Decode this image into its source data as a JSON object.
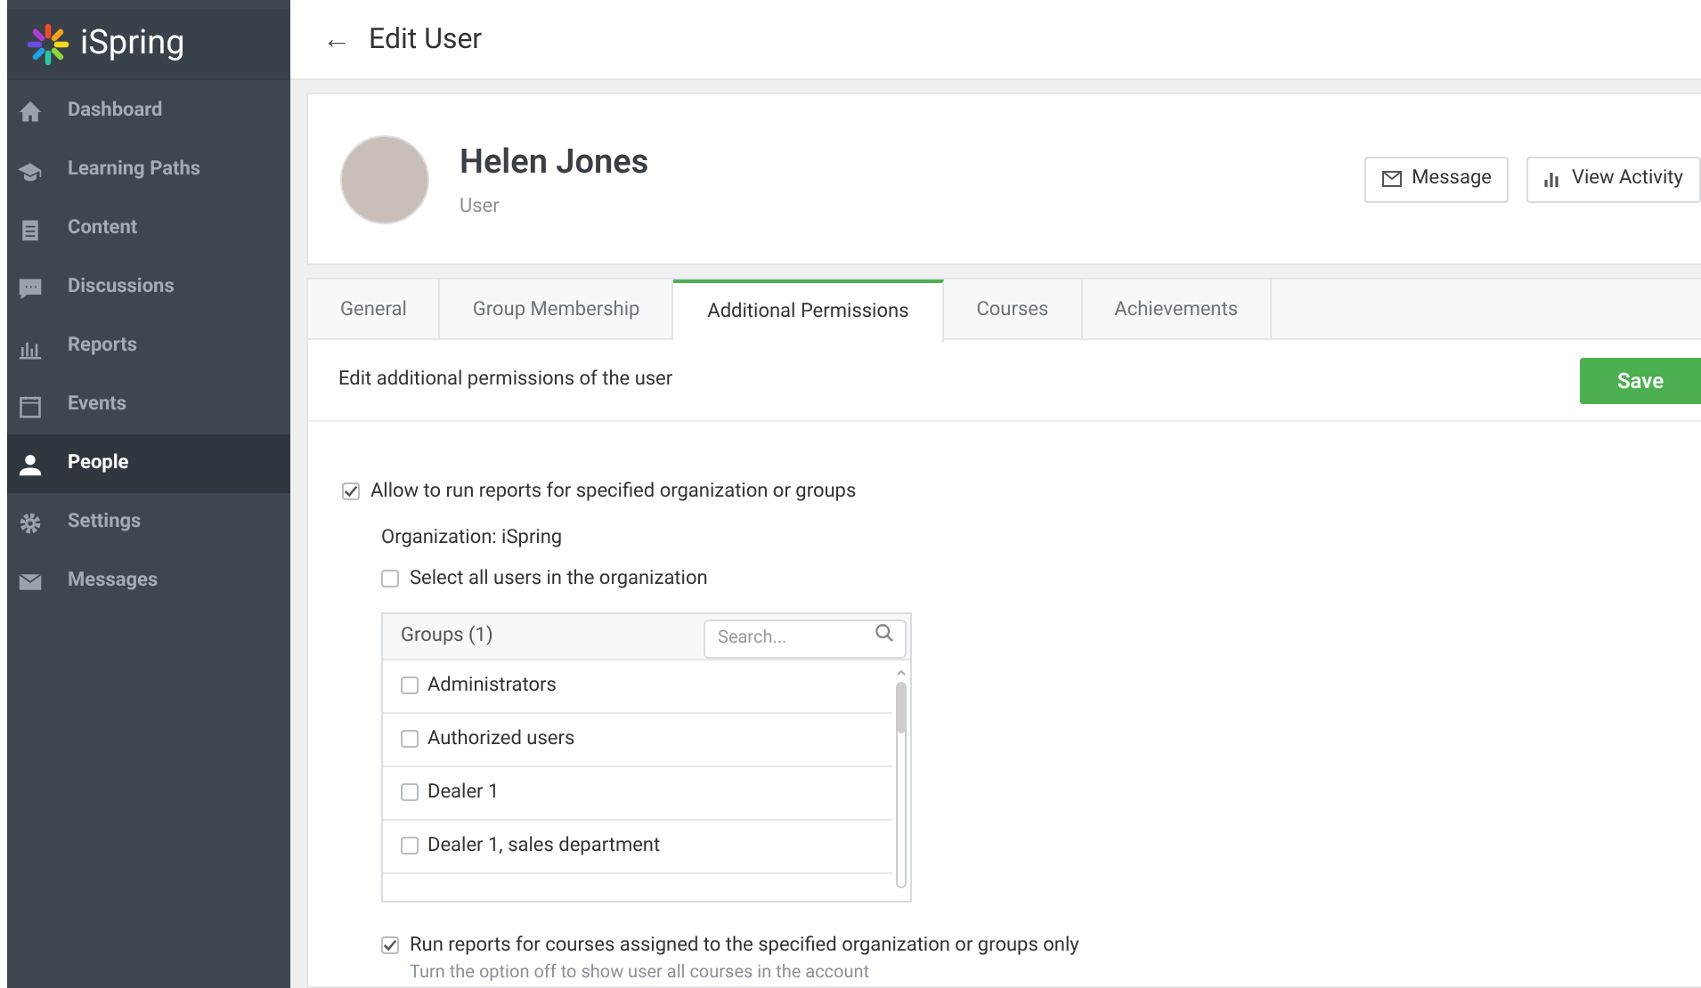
{
  "sidebar": {
    "logo": "iSpring",
    "items": [
      {
        "label": "Dashboard",
        "selected": false
      },
      {
        "label": "Learning Paths",
        "selected": false
      },
      {
        "label": "Content",
        "selected": false
      },
      {
        "label": "Discussions",
        "selected": false
      },
      {
        "label": "Reports",
        "selected": false
      },
      {
        "label": "Events",
        "selected": false
      },
      {
        "label": "People",
        "selected": true
      },
      {
        "label": "Settings",
        "selected": false
      },
      {
        "label": "Messages",
        "selected": false
      }
    ]
  },
  "header": {
    "back": "←",
    "title": "Edit User"
  },
  "user": {
    "name": "Helen Jones",
    "role": "User",
    "actions": [
      {
        "label": "Message"
      },
      {
        "label": "View Activity"
      }
    ]
  },
  "tabs": [
    {
      "label": "General",
      "selected": false
    },
    {
      "label": "Group Membership",
      "selected": false
    },
    {
      "label": "Additional Permissions",
      "selected": true
    },
    {
      "label": "Courses",
      "selected": false
    },
    {
      "label": "Achievements",
      "selected": false
    }
  ],
  "description": "Edit additional permissions of the user",
  "save": "Save",
  "allow": {
    "label": "Allow to run reports for specified organization or groups",
    "checked": true
  },
  "organization": "Organization: iSpring",
  "select_all": {
    "label": "Select all users in the organization",
    "checked": false
  },
  "groups": {
    "title": "Groups (1)",
    "search_placeholder": "Search...",
    "items": [
      {
        "label": "Administrators",
        "checked": false
      },
      {
        "label": "Authorized users",
        "checked": false
      },
      {
        "label": "Dealer 1",
        "checked": false
      },
      {
        "label": "Dealer 1, sales department",
        "checked": false
      }
    ]
  },
  "courses_only": {
    "label": "Run reports for courses assigned to the specified organization or groups only",
    "checked": true,
    "hint": "Turn the option off to show user all courses in the account"
  }
}
